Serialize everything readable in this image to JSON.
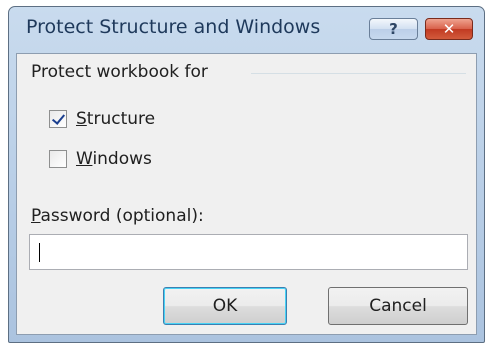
{
  "dialog": {
    "title": "Protect Structure and Windows",
    "help_glyph": "?",
    "close_glyph": "✕",
    "group_label": "Protect workbook for",
    "options": [
      {
        "label": "Structure",
        "accesskey": "S",
        "rest": "tructure",
        "checked": true
      },
      {
        "label": "Windows",
        "accesskey": "W",
        "rest": "indows",
        "checked": false
      }
    ],
    "password_label_key": "P",
    "password_label_rest": "assword (optional):",
    "password_value": "",
    "ok_label": "OK",
    "cancel_label": "Cancel"
  },
  "colors": {
    "title_text": "#1e395b",
    "frame": "#b7cde6",
    "client_bg": "#f0f0f0",
    "close_red": "#c13a22",
    "checkmark": "#1b3f8f"
  },
  "icons": {
    "help": "question-mark-icon",
    "close": "close-icon",
    "check": "checkmark-icon"
  }
}
